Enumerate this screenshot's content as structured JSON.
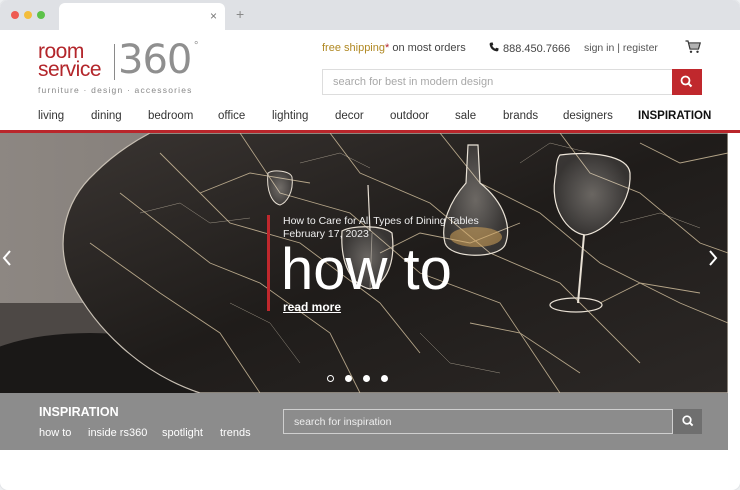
{
  "browser": {
    "tab_close": "×",
    "new_tab": "+"
  },
  "logo": {
    "word1": "room",
    "word2": "service",
    "number": "360",
    "degree": "°",
    "tagline": "furniture · design · accessories"
  },
  "header": {
    "promo_free": "free shipping",
    "promo_asterisk": "*",
    "promo_rest": " on most orders",
    "phone": "888.450.7666",
    "account": "sign in | register",
    "search_placeholder": "search for best in modern design"
  },
  "nav": {
    "items": [
      "living",
      "dining",
      "bedroom",
      "office",
      "lighting",
      "decor",
      "outdoor",
      "sale",
      "brands",
      "designers",
      "INSPIRATION"
    ]
  },
  "hero": {
    "subtitle": "How to Care for All Types of Dining Tables",
    "date": "February 17, 2023",
    "title": "how to",
    "link": "read more",
    "prev": "‹",
    "next": "›",
    "slide_count": 4,
    "active_slide": 1
  },
  "inspiration": {
    "title": "INSPIRATION",
    "links": [
      "how to",
      "inside rs360",
      "spotlight",
      "trends"
    ],
    "search_placeholder": "search for inspiration"
  },
  "colors": {
    "brand_red": "#b9262b",
    "logo_gray": "#8f8f8f",
    "inspiration_bar": "#8c8c8c"
  }
}
